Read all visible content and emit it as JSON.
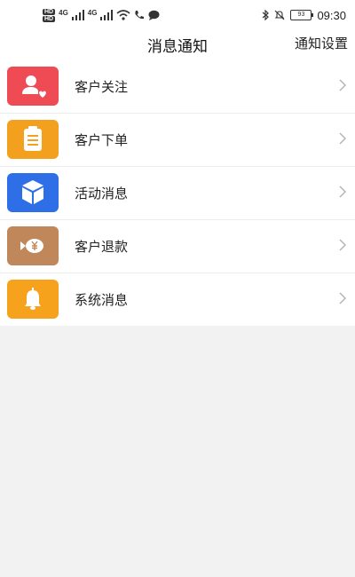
{
  "statusbar": {
    "hd_label": "HD",
    "net_label": "4G",
    "battery": "93",
    "time": "09:30"
  },
  "header": {
    "title": "消息通知",
    "settings_label": "通知设置"
  },
  "items": [
    {
      "label": "客户关注",
      "icon": "user-heart-icon",
      "color": "#ee4b55"
    },
    {
      "label": "客户下单",
      "icon": "clipboard-icon",
      "color": "#f4a01f"
    },
    {
      "label": "活动消息",
      "icon": "box-icon",
      "color": "#2e6fe8"
    },
    {
      "label": "客户退款",
      "icon": "yen-refund-icon",
      "color": "#c0875a"
    },
    {
      "label": "系统消息",
      "icon": "bell-icon",
      "color": "#f6a21d"
    }
  ]
}
